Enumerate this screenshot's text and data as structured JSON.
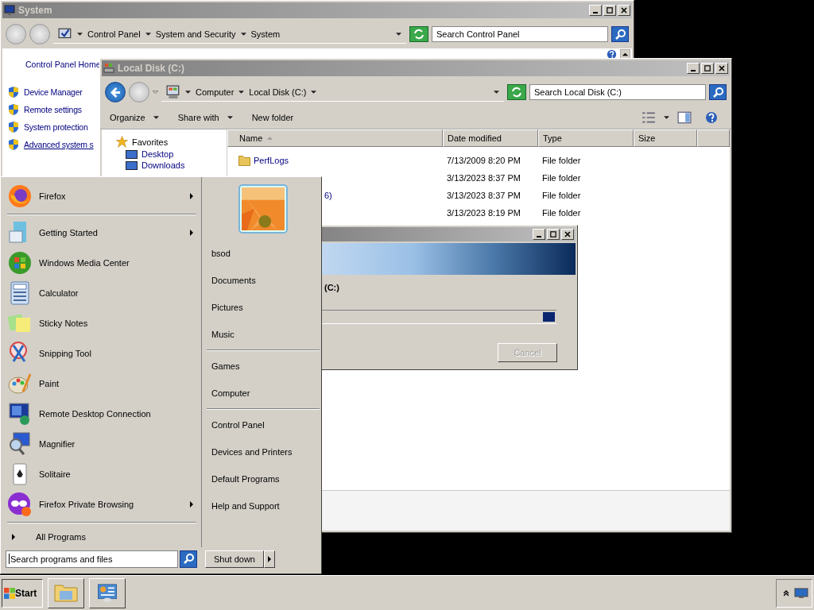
{
  "system_window": {
    "title": "System",
    "breadcrumb": [
      "Control Panel",
      "System and Security",
      "System"
    ],
    "search": {
      "placeholder": "Search Control Panel"
    },
    "home_link": "Control Panel Home",
    "tasks": [
      {
        "label": "Device Manager",
        "underlined": false
      },
      {
        "label": "Remote settings",
        "underlined": false
      },
      {
        "label": "System protection",
        "underlined": false
      },
      {
        "label": "Advanced system s",
        "underlined": true
      }
    ]
  },
  "explorer_window": {
    "title": "Local Disk (C:)",
    "breadcrumb": [
      "Computer",
      "Local Disk (C:)"
    ],
    "search": {
      "placeholder": "Search Local Disk (C:)"
    },
    "toolbar": [
      {
        "label": "Organize",
        "dropdown": true
      },
      {
        "label": "Share with",
        "dropdown": true
      },
      {
        "label": "New folder",
        "dropdown": false
      }
    ],
    "nav": {
      "heading": "Favorites",
      "items": [
        "Desktop",
        "Downloads"
      ]
    },
    "columns": [
      "Name",
      "Date modified",
      "Type",
      "Size"
    ],
    "rows": [
      {
        "name": "PerfLogs",
        "name_cut": false,
        "date": "7/13/2009 8:20 PM",
        "type": "File folder"
      },
      {
        "date": "3/13/2023 8:37 PM",
        "type": "File folder"
      },
      {
        "name": "6)",
        "name_cut": true,
        "date": "3/13/2023 8:37 PM",
        "type": "File folder"
      },
      {
        "date": "3/13/2023 8:19 PM",
        "type": "File folder"
      }
    ]
  },
  "progress_dialog": {
    "drive": "(C:)",
    "cancel": {
      "label": "Cancel",
      "disabled": true
    }
  },
  "start_menu": {
    "programs": [
      {
        "label": "Firefox",
        "kind": "firefox",
        "submenu": true
      },
      {
        "label": "Getting Started",
        "kind": "getting-started",
        "submenu": true
      },
      {
        "label": "Windows Media Center",
        "kind": "media-center",
        "submenu": false
      },
      {
        "label": "Calculator",
        "kind": "calculator",
        "submenu": false
      },
      {
        "label": "Sticky Notes",
        "kind": "sticky-notes",
        "submenu": false
      },
      {
        "label": "Snipping Tool",
        "kind": "snipping",
        "submenu": false
      },
      {
        "label": "Paint",
        "kind": "paint",
        "submenu": false
      },
      {
        "label": "Remote Desktop Connection",
        "kind": "remote-desktop",
        "submenu": false
      },
      {
        "label": "Magnifier",
        "kind": "magnifier",
        "submenu": false
      },
      {
        "label": "Solitaire",
        "kind": "solitaire",
        "submenu": false
      },
      {
        "label": "Firefox Private Browsing",
        "kind": "private",
        "submenu": true
      }
    ],
    "all_programs": "All Programs",
    "places": [
      [
        "bsod",
        "Documents",
        "Pictures",
        "Music"
      ],
      [
        "Games",
        "Computer"
      ],
      [
        "Control Panel",
        "Devices and Printers",
        "Default Programs",
        "Help and Support"
      ]
    ],
    "search": {
      "placeholder": "Search programs and files"
    },
    "shutdown": "Shut down"
  },
  "taskbar": {
    "start": "Start"
  }
}
